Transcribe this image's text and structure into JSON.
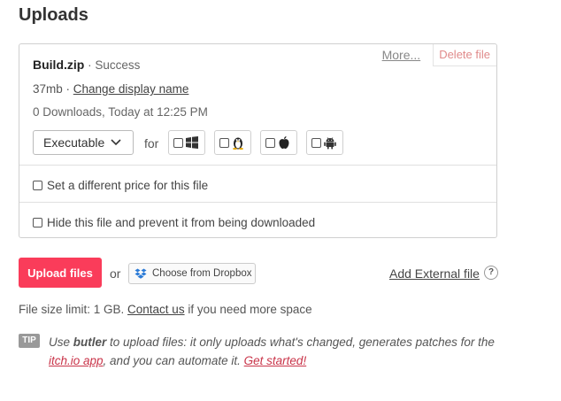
{
  "page": {
    "title": "Uploads"
  },
  "file": {
    "name": "Build.zip",
    "status": " · Success",
    "size": "37mb · ",
    "change_name_link": "Change display name",
    "downloads": "0 Downloads, Today at 12:25 PM",
    "more_link": "More...",
    "delete_label": "Delete file",
    "type_value": "Executable",
    "for_label": "for",
    "platforms": [
      "windows-icon",
      "linux-icon",
      "apple-icon",
      "android-icon"
    ]
  },
  "options": {
    "price_label": "Set a different price for this file",
    "hide_label": "Hide this file and prevent it from being downloaded"
  },
  "actions": {
    "upload_label": "Upload files",
    "or_label": "or",
    "dropbox_label": "Choose from Dropbox",
    "external_label": "Add External file",
    "help": "?"
  },
  "limit": {
    "prefix": "File size limit: 1 GB. ",
    "link": "Contact us",
    "suffix": " if you need more space"
  },
  "tip": {
    "badge": "TIP",
    "t1": "Use ",
    "butler": "butler",
    "t2": " to upload files: it only uploads what's changed, generates patches for the ",
    "itch_link": "itch.io app",
    "t3": ", and you can automate it. ",
    "start_link": "Get started!"
  },
  "colors": {
    "accent": "#fa3c5a",
    "delete": "#e08a8a",
    "tip_badge": "#999999"
  }
}
